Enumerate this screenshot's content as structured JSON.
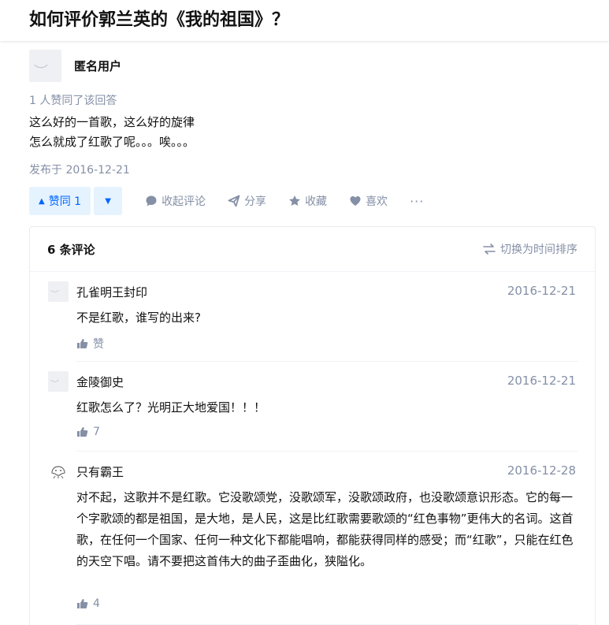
{
  "question": {
    "title": "如何评价郭兰英的《我的祖国》？"
  },
  "answer": {
    "author": "匿名用户",
    "voters": "1 人赞同了该回答",
    "content": [
      "这么好的一首歌，这么好的旋律",
      "怎么就成了红歌了呢。。。唉。。。"
    ],
    "published": "发布于 2016-12-21",
    "actions": {
      "vote_up": "赞同 1",
      "comment": "收起评论",
      "share": "分享",
      "favorite": "收藏",
      "like": "喜欢",
      "more": "···"
    }
  },
  "comments_section": {
    "count": "6 条评论",
    "sort": "切换为时间排序",
    "items": [
      {
        "name": "孔雀明王封印",
        "time": "2016-12-21",
        "text": "不是红歌，谁写的出来?",
        "likes": "赞"
      },
      {
        "name": "金陵御史",
        "time": "2016-12-21",
        "text": "红歌怎么了？光明正大地爱国！！！",
        "likes": "7"
      },
      {
        "name": "只有霸王",
        "time": "2016-12-28",
        "text": "对不起，这歌并不是红歌。它没歌颂党，没歌颂军，没歌颂政府，也没歌颂意识形态。它的每一个字歌颂的都是祖国，是大地，是人民，这是比红歌需要歌颂的“红色事物”更伟大的名词。这首歌，在任何一个国家、任何一种文化下都能唱响，都能获得同样的感受；而“红歌”，只能在红色的天空下唱。请不要把这首伟大的曲子歪曲化，狭隘化。",
        "likes": "4"
      }
    ]
  },
  "colors": {
    "accent": "#0066ff",
    "muted": "#8590a6",
    "text": "#121212"
  }
}
